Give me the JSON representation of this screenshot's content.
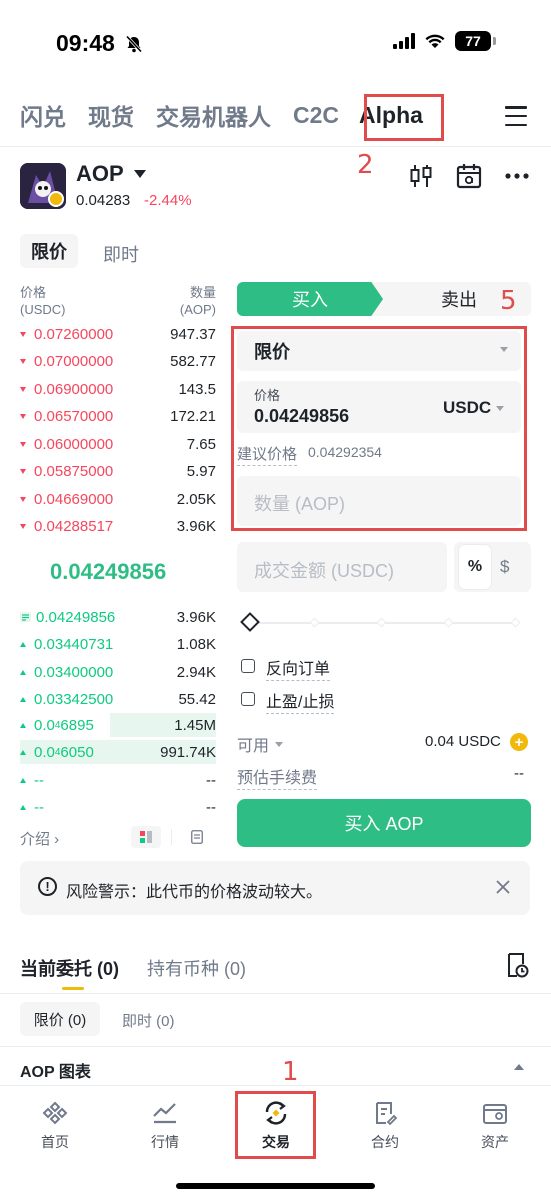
{
  "status": {
    "time": "09:48",
    "battery": "77"
  },
  "nav": {
    "tabs": [
      "闪兑",
      "现货",
      "交易机器人",
      "C2C",
      "Alpha"
    ],
    "active": "Alpha"
  },
  "annotations": {
    "a1": "1",
    "a2": "2",
    "a5": "5"
  },
  "token": {
    "symbol": "AOP",
    "price": "0.04283",
    "change": "-2.44%"
  },
  "order_types": {
    "limit": "限价",
    "market": "即时"
  },
  "orderbook": {
    "price_header": "价格",
    "price_unit": "(USDC)",
    "qty_header": "数量",
    "qty_unit": "(AOP)",
    "asks": [
      {
        "price": "0.07260000",
        "qty": "947.37"
      },
      {
        "price": "0.07000000",
        "qty": "582.77"
      },
      {
        "price": "0.06900000",
        "qty": "143.5"
      },
      {
        "price": "0.06570000",
        "qty": "172.21"
      },
      {
        "price": "0.06000000",
        "qty": "7.65"
      },
      {
        "price": "0.05875000",
        "qty": "5.97"
      },
      {
        "price": "0.04669000",
        "qty": "2.05K"
      },
      {
        "price": "0.04288517",
        "qty": "3.96K"
      }
    ],
    "mid_price": "0.04249856",
    "bids": [
      {
        "price": "0.04249856",
        "qty": "3.96K"
      },
      {
        "price": "0.03440731",
        "qty": "1.08K"
      },
      {
        "price": "0.03400000",
        "qty": "2.94K"
      },
      {
        "price": "0.03342500",
        "qty": "55.42"
      },
      {
        "price_pre": "0.0",
        "price_sub": "4",
        "price_post": "6895",
        "qty": "1.45M"
      },
      {
        "price_pre": "0.0",
        "price_sub": "4",
        "price_post": "6050",
        "qty": "991.74K"
      },
      {
        "price": "--",
        "qty": "--"
      },
      {
        "price": "--",
        "qty": "--"
      }
    ]
  },
  "trade": {
    "buy": "买入",
    "sell": "卖出",
    "order_type": "限价",
    "price_label": "价格",
    "price_value": "0.04249856",
    "currency": "USDC",
    "suggest_label": "建议价格",
    "suggest_value": "0.04292354",
    "qty_placeholder": "数量 (AOP)",
    "amount_placeholder": "成交金额 (USDC)",
    "pct": "%",
    "usd": "$",
    "reverse_order": "反向订单",
    "tp_sl": "止盈/止损",
    "available_label": "可用",
    "available_value": "0.04 USDC",
    "fee_label": "预估手续费",
    "fee_value": "--",
    "buy_button": "买入 AOP"
  },
  "intro": "介绍 ›",
  "risk": "风险警示：此代币的价格波动较大。",
  "bottom_tabs": {
    "open_orders": "当前委托 (0)",
    "holdings": "持有币种 (0)",
    "limit": "限价 (0)",
    "market": "即时 (0)",
    "chart": "AOP 图表"
  },
  "bottom_nav": [
    "首页",
    "行情",
    "交易",
    "合约",
    "资产"
  ],
  "colors": {
    "green": "#2ebd85",
    "red": "#f6465d",
    "annotation": "#e04b4b",
    "accent": "#f0b90b"
  }
}
